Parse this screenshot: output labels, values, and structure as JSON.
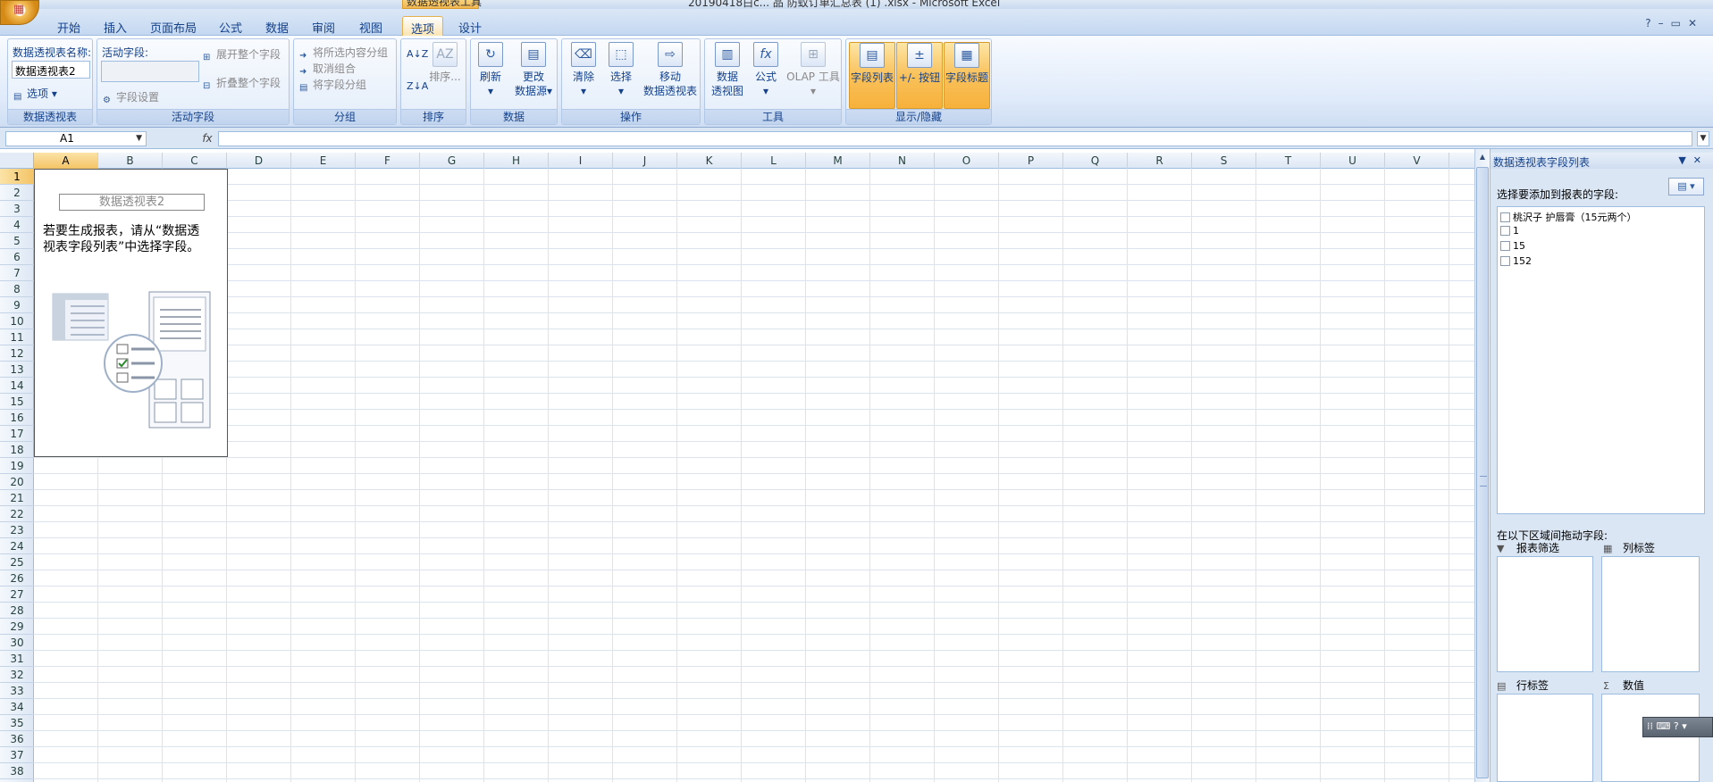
{
  "title_bar": {
    "title": "20190418白c... 品 防蚊订单汇总表 (1) .xlsx - Microsoft Excel",
    "context_tab": "数据透视表工具"
  },
  "tabs": [
    {
      "label": "开始",
      "active": false
    },
    {
      "label": "插入",
      "active": false
    },
    {
      "label": "页面布局",
      "active": false
    },
    {
      "label": "公式",
      "active": false
    },
    {
      "label": "数据",
      "active": false
    },
    {
      "label": "审阅",
      "active": false
    },
    {
      "label": "视图",
      "active": false
    },
    {
      "label": "选项",
      "active": true
    },
    {
      "label": "设计",
      "active": false
    }
  ],
  "ribbon": {
    "pivot": {
      "name_label": "数据透视表名称:",
      "name_value": "数据透视表2",
      "options": "选项",
      "group": "数据透视表"
    },
    "active_field": {
      "label": "活动字段:",
      "value": "",
      "field_settings": "字段设置",
      "expand_all": "展开整个字段",
      "collapse_all": "折叠整个字段",
      "group": "活动字段"
    },
    "grouping": {
      "group_selection": "将所选内容分组",
      "ungroup": "取消组合",
      "group_field": "将字段分组",
      "group": "分组"
    },
    "sort": {
      "sort_az": "A↓Z",
      "sort_za": "Z↓A",
      "sort_btn": "排序...",
      "group": "排序"
    },
    "data": {
      "refresh": "刷新",
      "change_source_1": "更改",
      "change_source_2": "数据源",
      "group": "数据"
    },
    "actions": {
      "clear": "清除",
      "select": "选择",
      "move_1": "移动",
      "move_2": "数据透视表",
      "group": "操作"
    },
    "tools": {
      "pivotchart_1": "数据",
      "pivotchart_2": "透视图",
      "formulas": "公式",
      "olap": "OLAP 工具",
      "group": "工具"
    },
    "show_hide": {
      "field_list": "字段列表",
      "buttons": "+/- 按钮",
      "headers": "字段标题",
      "group": "显示/隐藏"
    }
  },
  "formula_bar": {
    "name_box": "A1",
    "fx": "fx",
    "formula": ""
  },
  "sheet": {
    "columns": [
      "A",
      "B",
      "C",
      "D",
      "E",
      "F",
      "G",
      "H",
      "I",
      "J",
      "K",
      "L",
      "M",
      "N",
      "O",
      "P",
      "Q",
      "R",
      "S",
      "T",
      "U",
      "V"
    ],
    "rows": [
      "1",
      "2",
      "3",
      "4",
      "5",
      "6",
      "7",
      "8",
      "9",
      "10",
      "11",
      "12",
      "13",
      "14",
      "15",
      "16",
      "17",
      "18",
      "19",
      "20",
      "21",
      "22",
      "23",
      "24",
      "25",
      "26",
      "27",
      "28",
      "29",
      "30",
      "31",
      "32",
      "33",
      "34",
      "35",
      "36",
      "37",
      "38"
    ],
    "selected_col": "A",
    "selected_row": "1",
    "pivot_placeholder": {
      "name": "数据透视表2",
      "hint_line1": "若要生成报表，请从“数据透",
      "hint_line2": "视表字段列表”中选择字段。"
    }
  },
  "field_pane": {
    "title": "数据透视表字段列表",
    "subtitle": "选择要添加到报表的字段:",
    "fields": [
      "桃沢子 护唇膏（15元两个）",
      "1",
      "15",
      "152"
    ],
    "drag_title": "在以下区域间拖动字段:",
    "areas": {
      "report_filter": "报表筛选",
      "column_labels": "列标签",
      "row_labels": "行标签",
      "values": "数值"
    }
  },
  "colors": {
    "ribbon_bg": "#dfeafa",
    "active_tab": "#fbe4b3",
    "highlight": "#f7b13b",
    "accent": "#15428b"
  }
}
